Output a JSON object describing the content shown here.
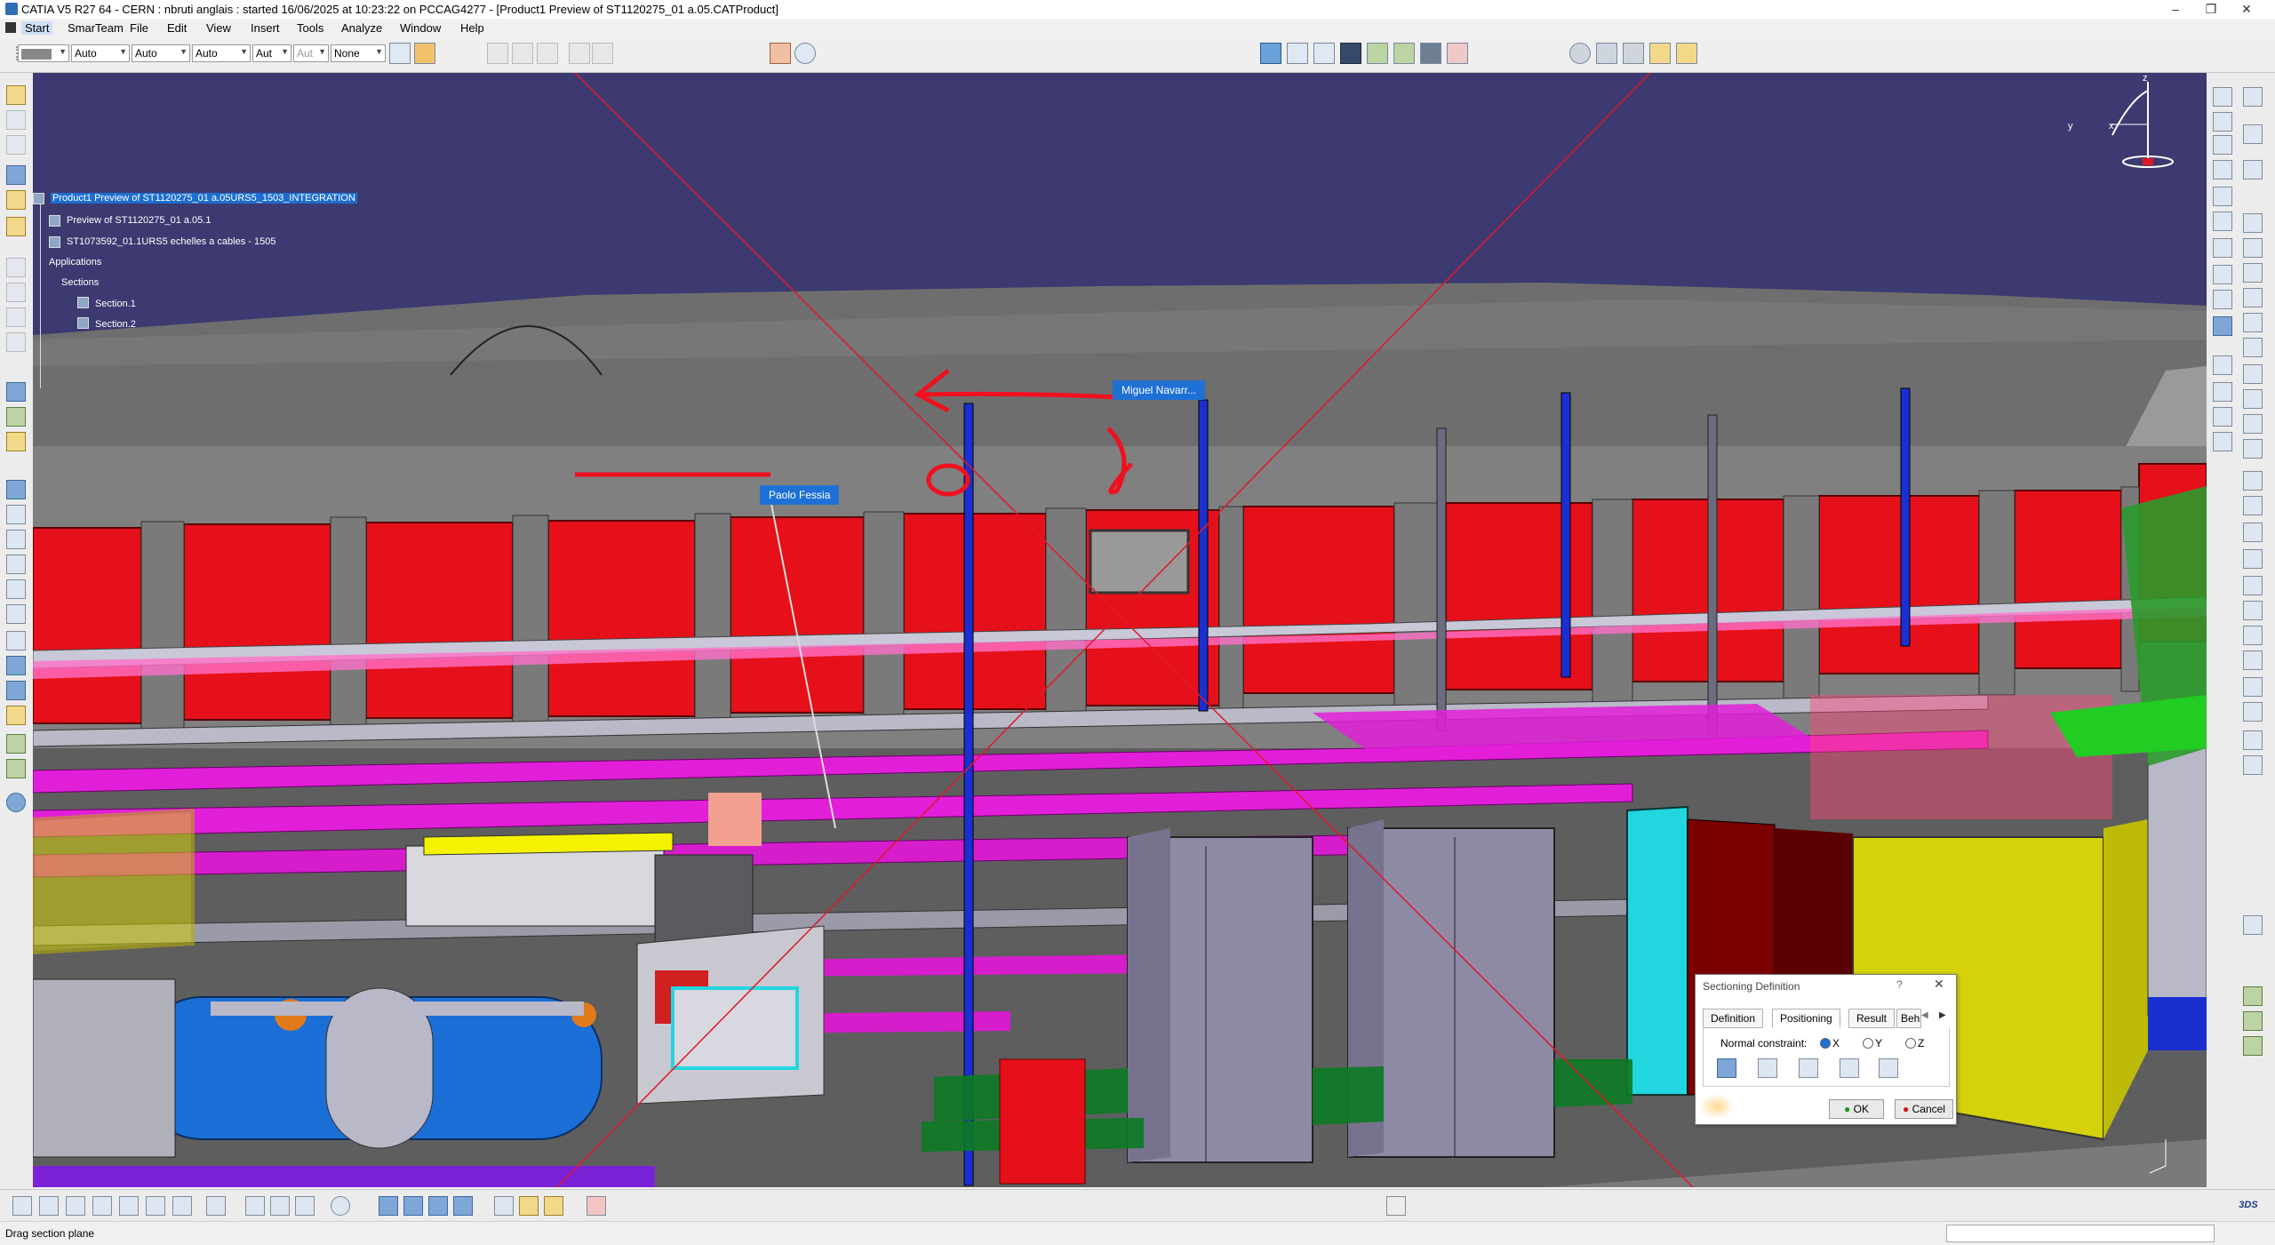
{
  "window": {
    "title": "CATIA V5 R27 64 -   CERN :  nbruti anglais : started 16/06/2025 at 10:23:22 on PCCAG4277 - [Product1 Preview of ST1120275_01 a.05.CATProduct]",
    "controls": {
      "minimize": "–",
      "restore": "❐",
      "close": "✕"
    }
  },
  "menu": {
    "items": [
      "Start",
      "SmarTeam",
      "File",
      "Edit",
      "View",
      "Insert",
      "Tools",
      "Analyze",
      "Window",
      "Help"
    ]
  },
  "toolbar": {
    "combos": [
      "",
      "Auto",
      "Auto",
      "Auto",
      "Aut",
      "Aut",
      "None"
    ]
  },
  "tree": {
    "root": "Product1 Preview of ST1120275_01 a.05URS5_1503_INTEGRATION",
    "children": [
      "Preview of ST1120275_01 a.05.1",
      "ST1073592_01.1URS5 echelles a cables - 1505",
      "Applications",
      "Sections",
      "Section.1",
      "Section.2"
    ]
  },
  "annotations": {
    "miguel": "Miguel Navarr...",
    "paolo": "Paolo Fessia"
  },
  "compass": {
    "x": "x",
    "y": "y",
    "z": "z"
  },
  "dialog": {
    "title": "Sectioning Definition",
    "help": "?",
    "close": "✕",
    "tabs": [
      "Definition",
      "Positioning",
      "Result",
      "Beh"
    ],
    "normal_constraint_label": "Normal constraint:",
    "options": [
      "X",
      "Y",
      "Z"
    ],
    "selected": "X",
    "ok": "OK",
    "cancel": "Cancel"
  },
  "status": {
    "text": "Drag section plane"
  },
  "colors": {
    "sky": "#3c3a70",
    "red_panels": "#e5101a",
    "magenta": "#e21fd8",
    "blue": "#1a2fd0",
    "yellow": "#d4d20a",
    "cyan": "#22d6e0",
    "cabinet": "#8e8aa6",
    "selection": "#1c6fd1"
  }
}
